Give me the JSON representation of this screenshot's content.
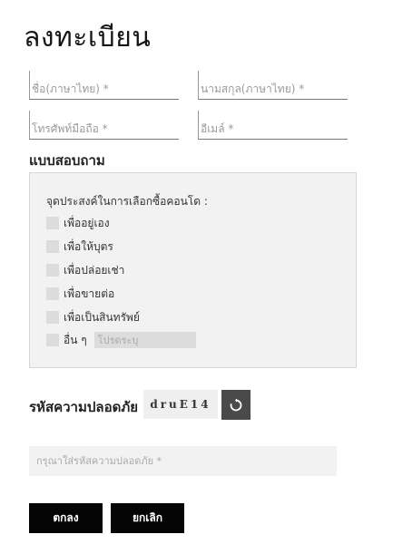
{
  "page": {
    "title": "ลงทะเบียน"
  },
  "form": {
    "name_placeholder": "ชื่อ(ภาษาไทย) *",
    "lastname_placeholder": "นามสกุล(ภาษาไทย) *",
    "phone_placeholder": "โทรศัพท์มือถือ *",
    "email_placeholder": "อีเมล์ *"
  },
  "survey": {
    "title": "แบบสอบถาม",
    "question": "จุดประสงค์ในการเลือกซื้อคอนโด :",
    "options": [
      "เพื่ออยู่เอง",
      "เพื่อให้บุตร",
      "เพื่อปล่อยเช่า",
      "เพื่อขายต่อ",
      "เพื่อเป็นสินทรัพย์",
      "อื่น ๆ"
    ],
    "other_placeholder": "โปรดระบุ"
  },
  "captcha": {
    "label": "รหัสความปลอดภัย",
    "code": "druE14",
    "input_placeholder": "กรุณาใส่รหัสความปลอดภัย *"
  },
  "buttons": {
    "ok": "ตกลง",
    "cancel": "ยกเลิก"
  },
  "colors": {
    "button_bg": "#050505",
    "refresh_bg": "#4a4a4a",
    "box_bg": "#f2f2f2"
  },
  "icons": {
    "refresh": "refresh-icon"
  }
}
